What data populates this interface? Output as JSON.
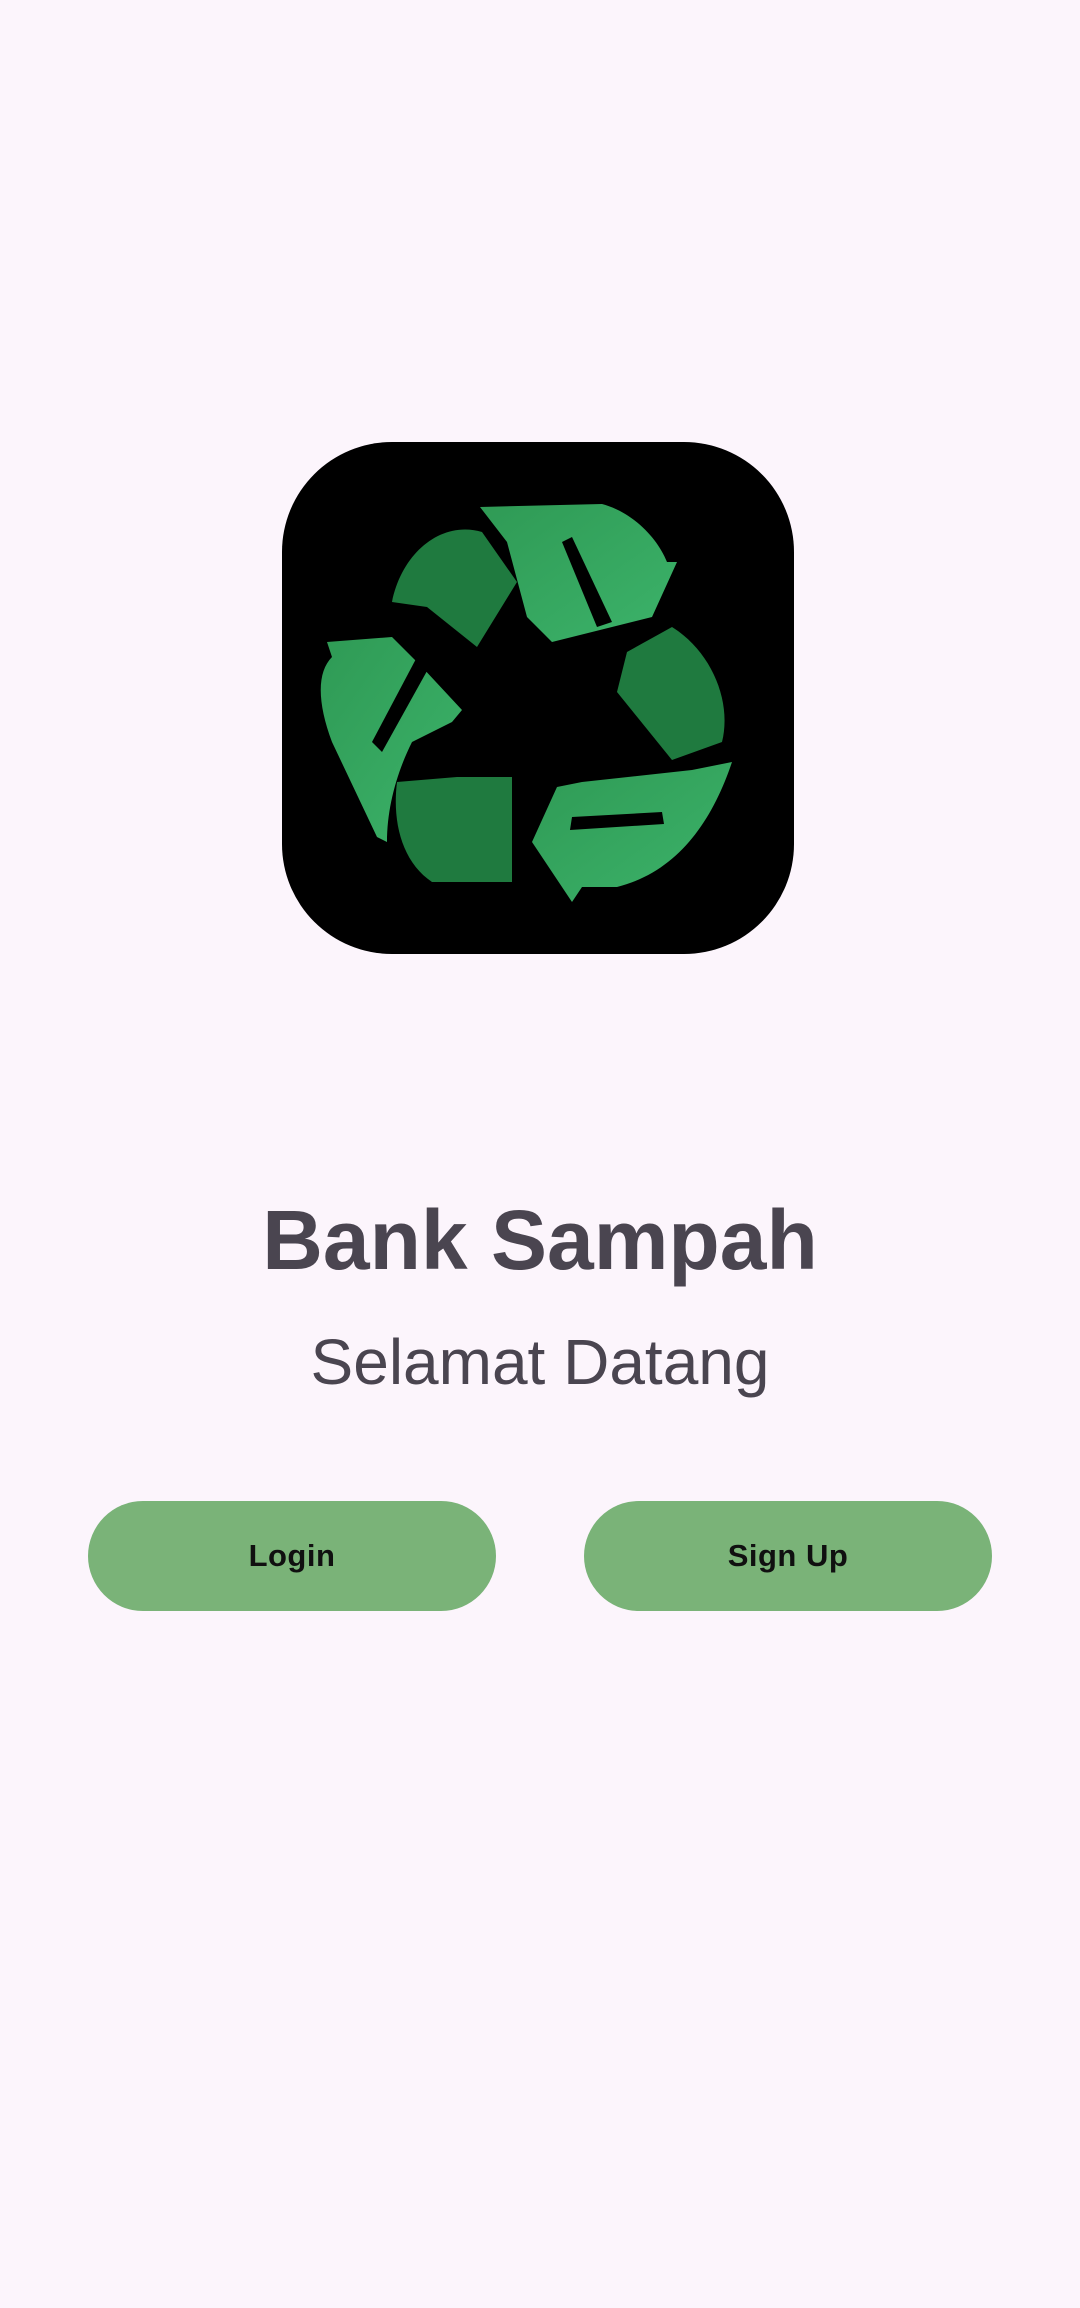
{
  "app": {
    "logo_icon": "recycle-icon",
    "title": "Bank Sampah",
    "subtitle": "Selamat Datang"
  },
  "actions": {
    "login_label": "Login",
    "signup_label": "Sign Up"
  },
  "colors": {
    "background": "#fcf5fc",
    "logo_background": "#000000",
    "logo_green_light": "#3cb36a",
    "logo_green_dark": "#1f7a3f",
    "button": "#7ab378",
    "text": "#4a4550"
  }
}
